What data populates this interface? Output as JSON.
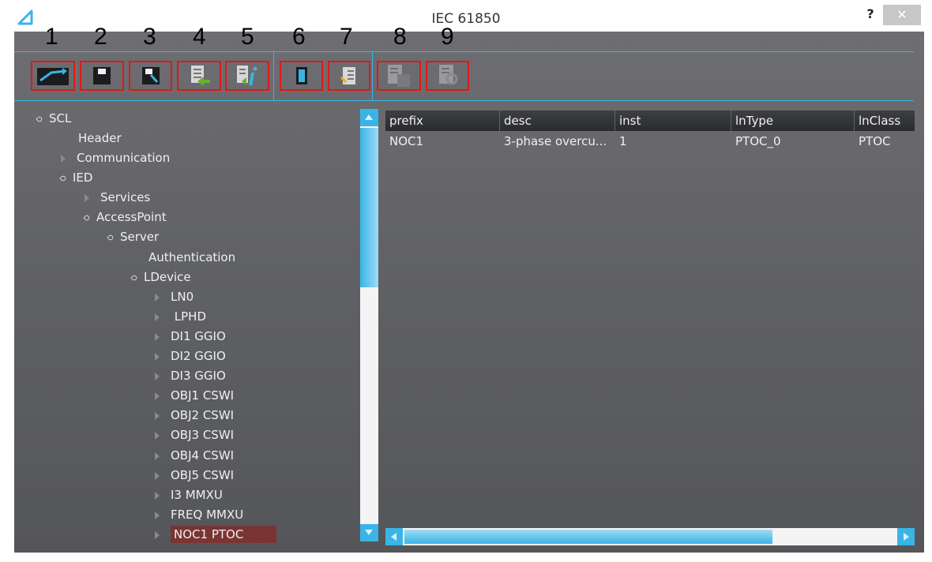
{
  "window": {
    "title": "IEC 61850",
    "help_label": "?",
    "close_label": "✕"
  },
  "toolbar": {
    "number_labels": [
      "1",
      "2",
      "3",
      "4",
      "5",
      "6",
      "7",
      "8",
      "9"
    ],
    "buttons": [
      {
        "icon": "open-file-icon",
        "enabled": true
      },
      {
        "icon": "save-icon",
        "enabled": true
      },
      {
        "icon": "save-as-icon",
        "enabled": true
      },
      {
        "icon": "import-list-icon",
        "enabled": true
      },
      {
        "icon": "list-info-icon",
        "enabled": true
      },
      {
        "icon": "device-icon",
        "enabled": true
      },
      {
        "icon": "edit-list-icon",
        "enabled": true
      },
      {
        "icon": "copy-disabled-icon",
        "enabled": false
      },
      {
        "icon": "search-disabled-icon",
        "enabled": false
      }
    ],
    "accent_color": "#3ab4e6",
    "highlight_color": "#e01818"
  },
  "tree": {
    "nodes": [
      {
        "label": "SCL",
        "state": "open"
      },
      {
        "label": "Header",
        "state": "leaf"
      },
      {
        "label": "Communication",
        "state": "closed"
      },
      {
        "label": "IED",
        "state": "open"
      },
      {
        "label": "Services",
        "state": "closed"
      },
      {
        "label": "AccessPoint",
        "state": "open"
      },
      {
        "label": "Server",
        "state": "open"
      },
      {
        "label": "Authentication",
        "state": "leaf"
      },
      {
        "label": "LDevice",
        "state": "open"
      },
      {
        "label": "LN0",
        "state": "closed"
      },
      {
        "label": " LPHD",
        "state": "closed"
      },
      {
        "label": "DI1 GGIO",
        "state": "closed"
      },
      {
        "label": "DI2 GGIO",
        "state": "closed"
      },
      {
        "label": "DI3 GGIO",
        "state": "closed"
      },
      {
        "label": "OBJ1 CSWI",
        "state": "closed"
      },
      {
        "label": "OBJ2 CSWI",
        "state": "closed"
      },
      {
        "label": "OBJ3 CSWI",
        "state": "closed"
      },
      {
        "label": "OBJ4 CSWI",
        "state": "closed"
      },
      {
        "label": "OBJ5 CSWI",
        "state": "closed"
      },
      {
        "label": "I3 MMXU",
        "state": "closed"
      },
      {
        "label": "FREQ MMXU",
        "state": "closed"
      },
      {
        "label": "NOC1 PTOC",
        "state": "closed",
        "selected": true
      }
    ],
    "selected_color": "#7a3432"
  },
  "grid": {
    "columns": [
      "prefix",
      "desc",
      "inst",
      "lnType",
      "lnClass"
    ],
    "rows": [
      [
        "NOC1",
        "3-phase overcu...",
        "1",
        "PTOC_0",
        "PTOC"
      ]
    ]
  }
}
